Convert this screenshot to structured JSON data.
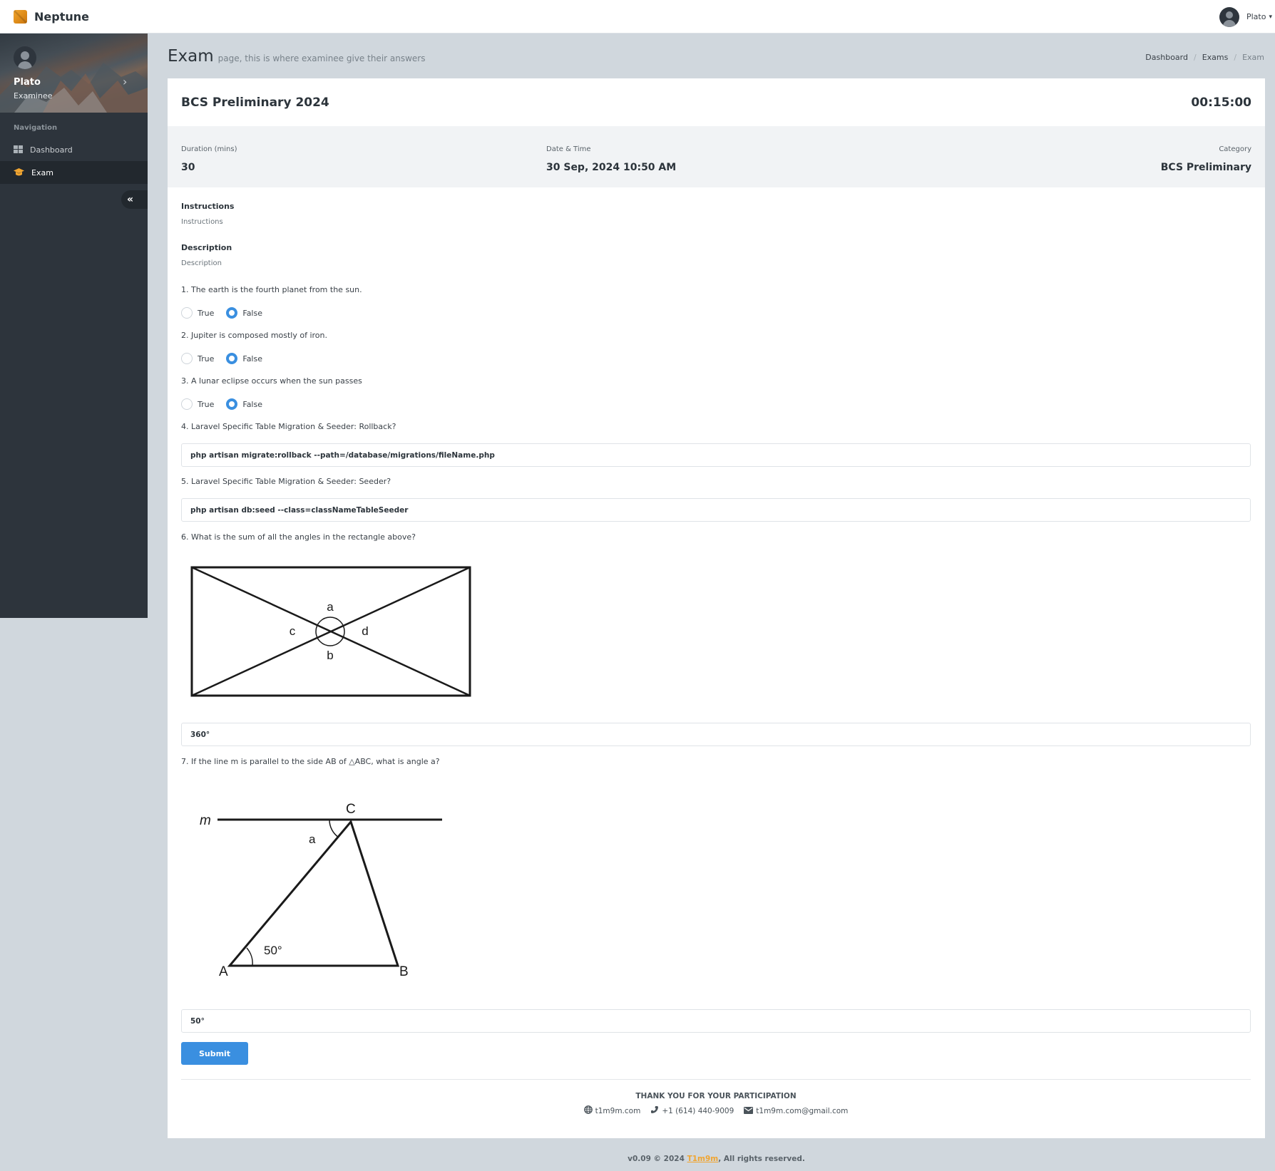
{
  "app": {
    "brand": "Neptune",
    "accent_color": "#f0a531",
    "primary_color": "#3a8fe0"
  },
  "topbar": {
    "user_name": "Plato",
    "caret": "▾"
  },
  "sidebar": {
    "profile": {
      "name": "Plato",
      "role": "Examinee",
      "chevron": "›"
    },
    "nav_header": "Navigation",
    "items": [
      {
        "label": "Dashboard",
        "icon": "dashboard-grid-icon",
        "active": false
      },
      {
        "label": "Exam",
        "icon": "graduation-cap-icon",
        "active": true
      }
    ],
    "collapse_label": "«"
  },
  "page": {
    "title": "Exam",
    "subtitle": "page, this is where examinee give their answers",
    "breadcrumb": [
      "Dashboard",
      "Exams",
      "Exam"
    ],
    "breadcrumb_sep": "/"
  },
  "exam": {
    "title": "BCS Preliminary 2024",
    "timer": "00:15:00",
    "meta": [
      {
        "label": "Duration (mins)",
        "value": "30"
      },
      {
        "label": "Date & Time",
        "value": "30 Sep, 2024 10:50 AM"
      },
      {
        "label": "Category",
        "value": "BCS Preliminary"
      }
    ],
    "instructions_title": "Instructions",
    "instructions_text": "Instructions",
    "description_title": "Description",
    "description_text": "Description",
    "questions": [
      {
        "text": "1. The earth is the fourth planet from the sun.",
        "type": "true_false",
        "options": [
          "True",
          "False"
        ],
        "selected": "False"
      },
      {
        "text": "2. Jupiter is composed mostly of iron.",
        "type": "true_false",
        "options": [
          "True",
          "False"
        ],
        "selected": "False"
      },
      {
        "text": "3. A lunar eclipse occurs when the sun passes",
        "type": "true_false",
        "options": [
          "True",
          "False"
        ],
        "selected": "False"
      },
      {
        "text": "4. Laravel Specific Table Migration & Seeder: Rollback?",
        "type": "text",
        "answer": "php artisan migrate:rollback --path=/database/migrations/fileName.php"
      },
      {
        "text": "5. Laravel Specific Table Migration & Seeder: Seeder?",
        "type": "text",
        "answer": "php artisan db:seed --class=classNameTableSeeder"
      },
      {
        "text": "6. What is the sum of all the angles in the rectangle above?",
        "type": "text",
        "answer": "360°",
        "figure": {
          "labels": [
            "a",
            "b",
            "c",
            "d"
          ]
        }
      },
      {
        "text": "7. If the line m is parallel to the side AB of △ABC, what is angle a?",
        "type": "text",
        "answer": "50°",
        "figure": {
          "line_label": "m",
          "vertices": [
            "A",
            "B",
            "C"
          ],
          "angle_label": "a",
          "given_angle": "50°"
        }
      }
    ],
    "submit_label": "Submit"
  },
  "card_footer": {
    "thanks": "THANK YOU FOR YOUR PARTICIPATION",
    "website": "t1m9m.com",
    "phone": "+1 (614) 440-9009",
    "email": "t1m9m.com@gmail.com"
  },
  "footer": {
    "prefix": "v0.09 © 2024 ",
    "link": "T1m9m",
    "suffix": ", All rights reserved."
  }
}
